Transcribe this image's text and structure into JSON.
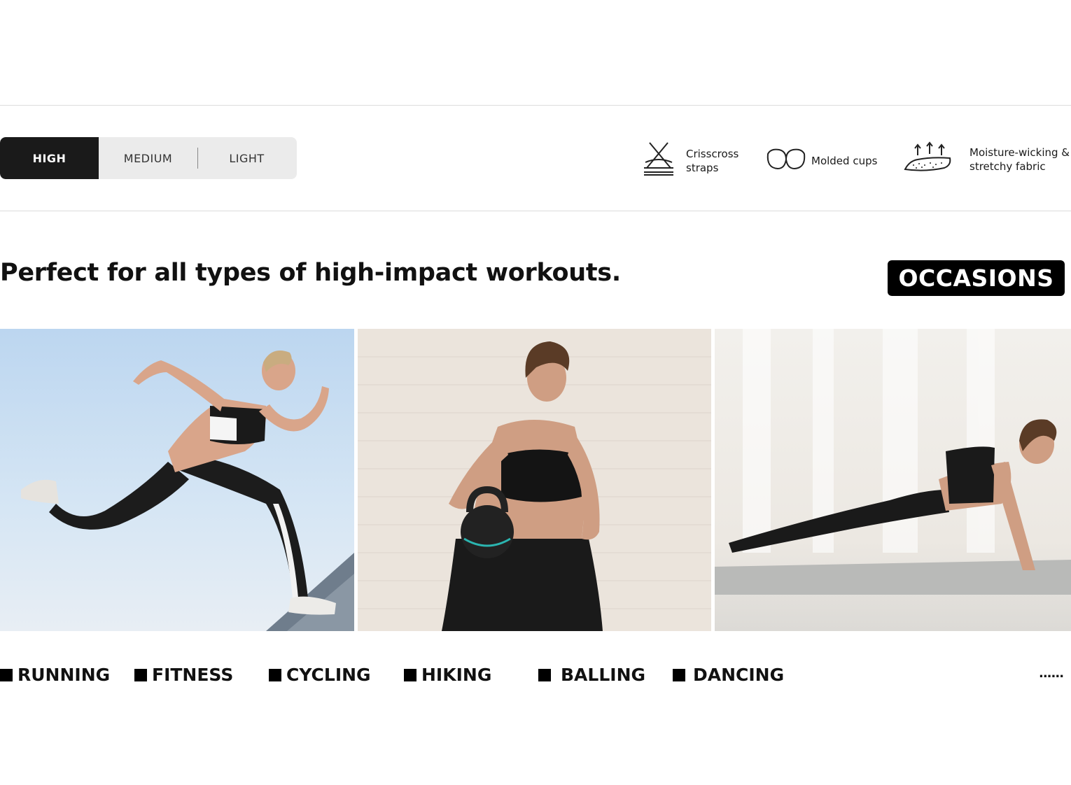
{
  "support_levels": {
    "items": [
      {
        "label": "HIGH",
        "active": true
      },
      {
        "label": "MEDIUM",
        "active": false
      },
      {
        "label": "LIGHT",
        "active": false
      }
    ]
  },
  "features": [
    {
      "icon": "crisscross-straps-icon",
      "label": "Crisscross straps"
    },
    {
      "icon": "molded-cups-icon",
      "label": "Molded cups"
    },
    {
      "icon": "moisture-wicking-icon",
      "label": "Moisture-wicking & stretchy fabric"
    }
  ],
  "headline": "Perfect for all types of high-impact workouts.",
  "badge": "OCCASIONS",
  "photos": [
    {
      "icon": "running-woman-photo"
    },
    {
      "icon": "kettlebell-woman-photo"
    },
    {
      "icon": "plank-woman-photo"
    }
  ],
  "occasions": [
    "RUNNING",
    "FITNESS",
    "CYCLING",
    "HIKING",
    "BALLING",
    "DANCING"
  ],
  "more": "......"
}
